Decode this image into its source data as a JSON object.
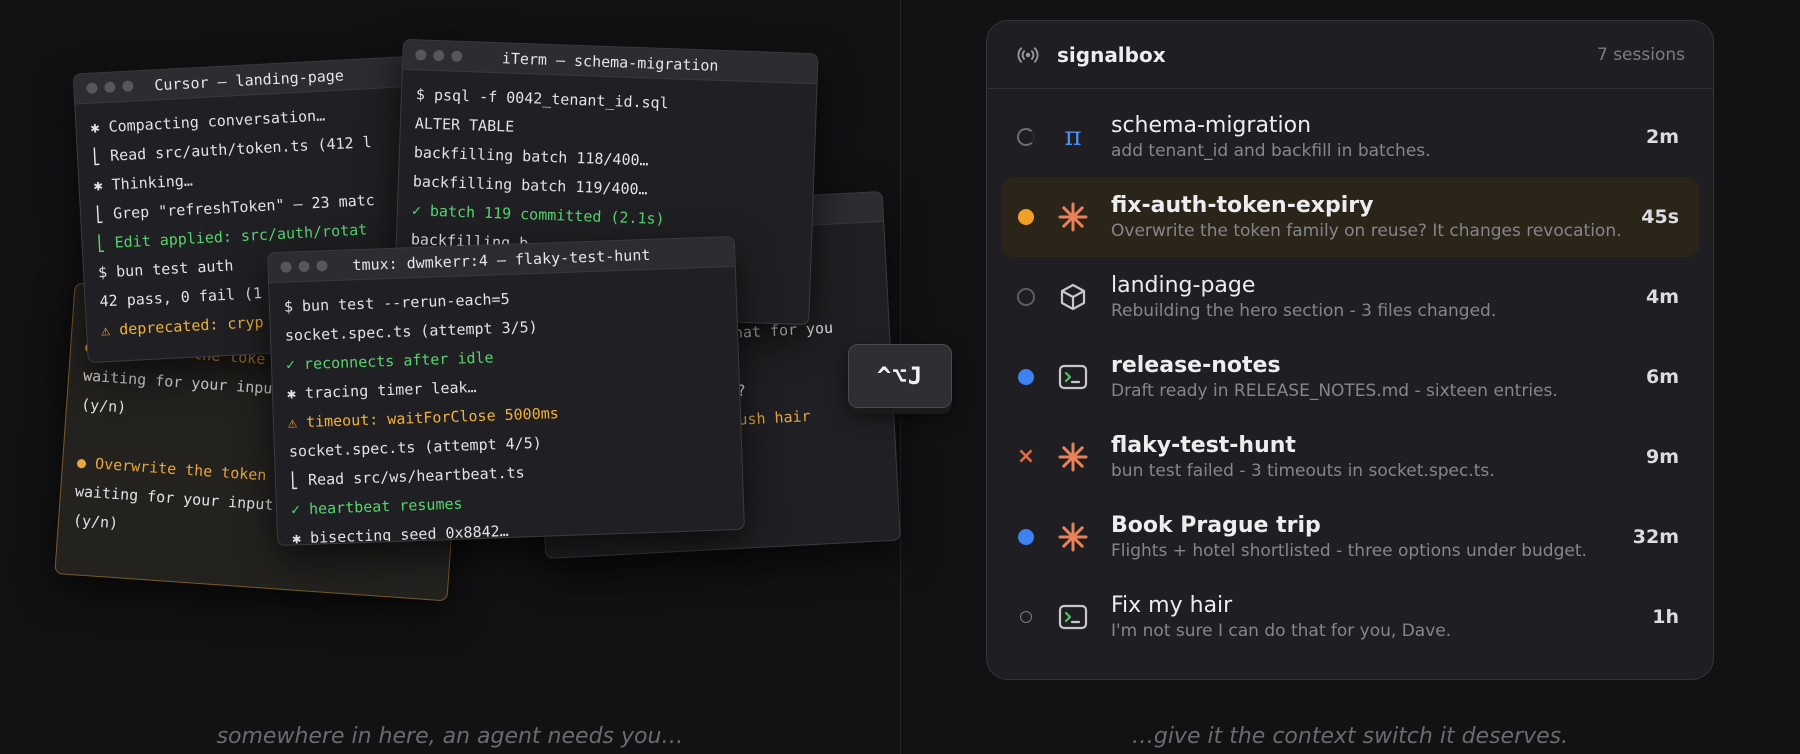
{
  "captions": {
    "left": "somewhere in here, an agent needs you…",
    "right": "…give it the context switch it deserves."
  },
  "shortcut": "^⌥J",
  "terminals": {
    "back": {
      "lines": [
        "hair",
        "that for you",
        "?",
        "h?",
        "lush hair"
      ]
    },
    "amber": {
      "lines": [
        "● Overwrite the toke",
        "waiting for your inpu",
        "(y/n)",
        "",
        "● Overwrite the token",
        "waiting for your input",
        "(y/n)"
      ]
    },
    "cursor": {
      "title": "Cursor — landing-page",
      "lines": [
        "✱ Compacting conversation…",
        " ⎣ Read src/auth/token.ts (412 l",
        "✱ Thinking…",
        " ⎣ Grep \"refreshToken\" — 23 matc",
        " ⎣ Edit applied: src/auth/rotat",
        "$ bun test auth",
        "42 pass, 0 fail (1",
        "⚠ deprecated: cryp"
      ]
    },
    "iterm": {
      "title": "iTerm — schema-migration",
      "lines": [
        "$ psql -f 0042_tenant_id.sql",
        "ALTER TABLE",
        "backfilling batch 118/400…",
        "backfilling batch 119/400…",
        "✓ batch 119 committed (2.1s)",
        "backfilling b"
      ]
    },
    "tmux": {
      "title": "tmux: dwmkerr:4 — flaky-test-hunt",
      "lines": [
        "$ bun test --rerun-each=5",
        "socket.spec.ts (attempt 3/5)",
        "✓ reconnects after idle",
        "✱ tracing timer leak…",
        "⚠ timeout: waitForClose 5000ms",
        "socket.spec.ts (attempt 4/5)",
        " ⎣ Read src/ws/heartbeat.ts",
        "✓ heartbeat resumes",
        "✱ bisecting seed 0x8842…"
      ]
    }
  },
  "panel": {
    "app_name": "signalbox",
    "session_count": "7 sessions",
    "sessions": [
      {
        "name": "schema-migration",
        "desc": "add tenant_id and backfill in batches.",
        "time": "2m"
      },
      {
        "name": "fix-auth-token-expiry",
        "desc": "Overwrite the token family on reuse? It changes revocation.",
        "time": "45s"
      },
      {
        "name": "landing-page",
        "desc": "Rebuilding the hero section - 3 files changed.",
        "time": "4m"
      },
      {
        "name": "release-notes",
        "desc": "Draft ready in RELEASE_NOTES.md - sixteen entries.",
        "time": "6m"
      },
      {
        "name": "flaky-test-hunt",
        "desc": "bun test failed - 3 timeouts in socket.spec.ts.",
        "time": "9m"
      },
      {
        "name": "Book Prague trip",
        "desc": "Flights + hotel shortlisted - three options under budget.",
        "time": "32m"
      },
      {
        "name": "Fix my hair",
        "desc": "I'm not sure I can do that for you, Dave.",
        "time": "1h"
      }
    ]
  },
  "icons": {
    "app": "signal-broadcast-icon",
    "agents": [
      "pi-icon",
      "sparkle-icon",
      "cube-icon",
      "terminal-icon",
      "sparkle-icon",
      "sparkle-icon",
      "terminal-icon"
    ],
    "statuses": [
      "spinner",
      "attention",
      "idle",
      "ready",
      "failed",
      "ready",
      "idle"
    ]
  },
  "colors": {
    "accent_orange": "#f0a028",
    "sparkle": "#e8825a",
    "blue": "#3d82ee",
    "failed": "#e06b45",
    "active_row": "#2b2418"
  }
}
